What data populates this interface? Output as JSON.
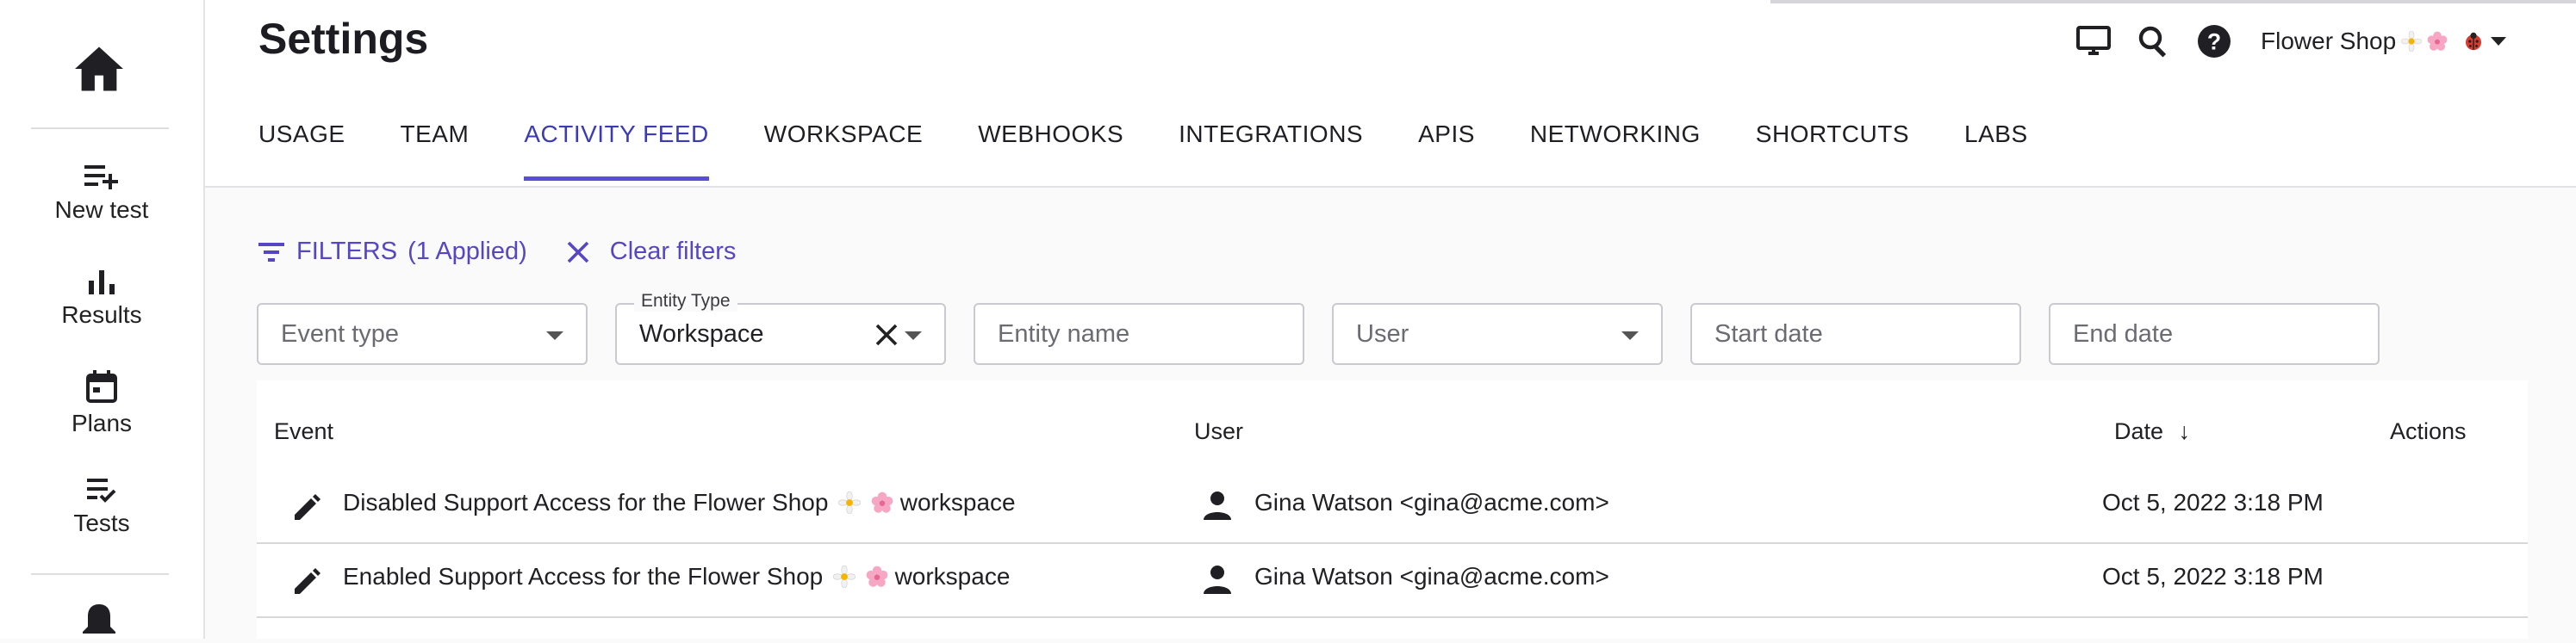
{
  "sidebar": {
    "items": [
      {
        "label": "New test",
        "icon": "playlist-add-icon"
      },
      {
        "label": "Results",
        "icon": "bar-chart-icon"
      },
      {
        "label": "Plans",
        "icon": "calendar-icon"
      },
      {
        "label": "Tests",
        "icon": "checklist-icon"
      }
    ]
  },
  "header": {
    "title": "Settings",
    "workspace_name": "Flower Shop",
    "tabs": [
      "USAGE",
      "TEAM",
      "ACTIVITY FEED",
      "WORKSPACE",
      "WEBHOOKS",
      "INTEGRATIONS",
      "APIS",
      "NETWORKING",
      "SHORTCUTS",
      "LABS"
    ],
    "active_tab": "ACTIVITY FEED"
  },
  "filters": {
    "label": "FILTERS",
    "applied": "(1 Applied)",
    "clear_label": "Clear filters",
    "event_type_placeholder": "Event type",
    "entity_type_label": "Entity Type",
    "entity_type_value": "Workspace",
    "entity_name_placeholder": "Entity name",
    "user_placeholder": "User",
    "start_date_placeholder": "Start date",
    "end_date_placeholder": "End date"
  },
  "table": {
    "columns": {
      "event": "Event",
      "user": "User",
      "date": "Date",
      "sort_arrow": "↓",
      "actions": "Actions"
    },
    "rows": [
      {
        "event_prefix": "Disabled Support Access for the Flower Shop",
        "event_suffix": "workspace",
        "user": "Gina Watson <gina@acme.com>",
        "date": "Oct 5, 2022 3:18 PM"
      },
      {
        "event_prefix": "Enabled Support Access for the Flower Shop",
        "event_suffix": "workspace",
        "user": "Gina Watson <gina@acme.com>",
        "date": "Oct 5, 2022 3:18 PM"
      }
    ]
  },
  "colors": {
    "accent": "#5b4ed6",
    "link": "#5646c4"
  }
}
